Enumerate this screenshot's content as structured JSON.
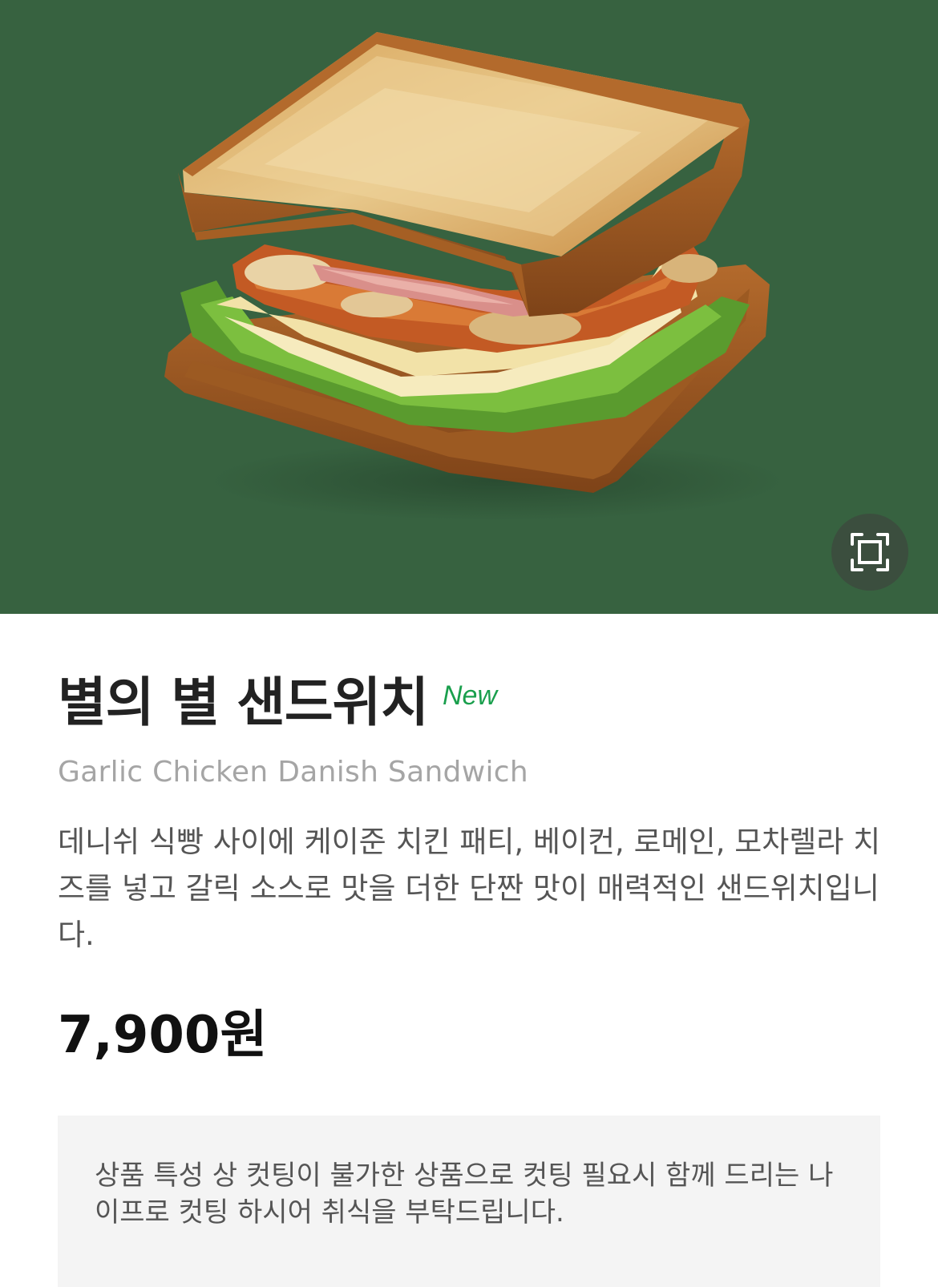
{
  "product": {
    "name_ko": "별의 별 샌드위치",
    "badge": "New",
    "name_en": "Garlic Chicken Danish Sandwich",
    "description": "데니쉬 식빵 사이에 케이준 치킨 패티, 베이컨, 로메인, 모차렐라 치즈를 넣고 갈릭 소스로 맛을 더한 단짠 맛이 매력적인 샌드위치입니다.",
    "price": "7,900원"
  },
  "notice": {
    "text": "상품 특성 상 컷팅이 불가한 상품으로 컷팅 필요시 함께 드리는 나이프로 컷팅 하시어 취식을 부탁드립니다."
  },
  "hero": {
    "image_icon": "sandwich-photo",
    "expand_icon": "fullscreen-icon"
  },
  "colors": {
    "hero_background": "#376240",
    "badge_green": "#1a9f4d",
    "notice_background": "#f4f4f4"
  }
}
